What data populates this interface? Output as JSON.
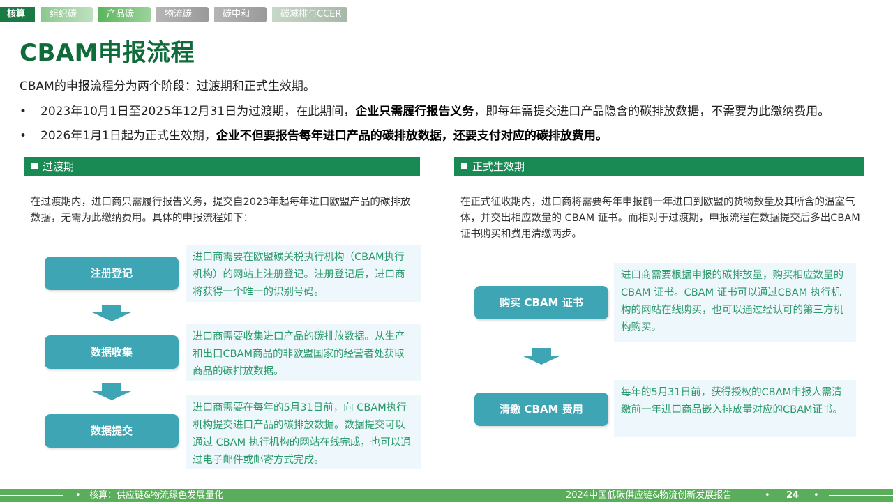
{
  "tabs": [
    "核算",
    "组织碳",
    "产品碳",
    "物流碳",
    "碳中和",
    "碳减排与CCER"
  ],
  "title": "CBAM申报流程",
  "intro": "CBAM的申报流程分为两个阶段：过渡期和正式生效期。",
  "bullets": [
    {
      "pre": "2023年10月1日至2025年12月31日为过渡期，在此期间，",
      "bold": "企业只需履行报告义务",
      "post": "，即每年需提交进口产品隐含的碳排放数据，不需要为此缴纳费用。"
    },
    {
      "pre": "2026年1月1日起为正式生效期，",
      "bold": "企业不但要报告每年进口产品的碳排放数据，还要支付对应的碳排放费用。",
      "post": ""
    }
  ],
  "left": {
    "header": "过渡期",
    "para": "在过渡期内，进口商只需履行报告义务，提交自2023年起每年进口欧盟产品的碳排放数据，无需为此缴纳费用。具体的申报流程如下：",
    "steps": [
      {
        "label": "注册登记",
        "desc": "进口商需要在欧盟碳关税执行机构（CBAM执行机构）的网站上注册登记。注册登记后，进口商将获得一个唯一的识别号码。"
      },
      {
        "label": "数据收集",
        "desc": "进口商需要收集进口产品的碳排放数据。从生产和出口CBAM商品的非欧盟国家的经营者处获取商品的碳排放数据。"
      },
      {
        "label": "数据提交",
        "desc": "进口商需要在每年的5月31日前，向 CBAM执行机构提交进口产品的碳排放数据。数据提交可以通过 CBAM 执行机构的网站在线完成，也可以通过电子邮件或邮寄方式完成。"
      }
    ]
  },
  "right": {
    "header": "正式生效期",
    "para": "在正式征收期内，进口商将需要每年申报前一年进口到欧盟的货物数量及其所含的温室气体，并交出相应数量的 CBAM 证书。而相对于过渡期，申报流程在数据提交后多出CBAM证书购买和费用清缴两步。",
    "steps": [
      {
        "label": "购买 CBAM 证书",
        "desc": "进口商需要根据申报的碳排放量，购买相应数量的 CBAM 证书。CBAM 证书可以通过CBAM 执行机构的网站在线购买，也可以通过经认可的第三方机构购买。"
      },
      {
        "label": "清缴 CBAM 费用",
        "desc": "每年的5月31日前，获得授权的CBAM申报人需清缴前一年进口商品嵌入排放量对应的CBAM证书。"
      }
    ]
  },
  "footer": {
    "left": "核算：供应链&物流绿色发展量化",
    "right": "2024中国低碳供应链&物流创新发展报告",
    "page": "24"
  }
}
